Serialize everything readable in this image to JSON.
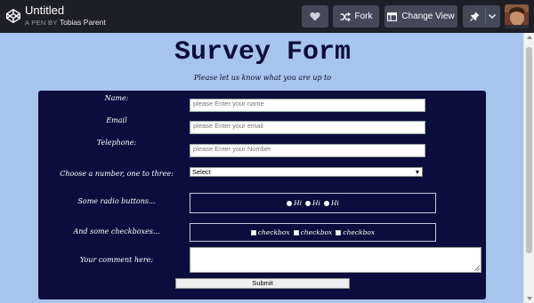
{
  "header": {
    "title": "Untitled",
    "by_prefix": "A PEN BY",
    "author": "Tobias Parent",
    "fork_label": "Fork",
    "change_view_label": "Change View"
  },
  "survey": {
    "title": "Survey Form",
    "description": "Please let us know what you are up to",
    "fields": {
      "name_label": "Name:",
      "name_placeholder": "please Enter your name",
      "email_label": "Email",
      "email_placeholder": "please Enter your email",
      "phone_label": "Telephone:",
      "phone_placeholder": "please Enter your Number",
      "number_label": "Choose a number, one to three:",
      "number_selected": "Select",
      "radio_label": "Some radio buttons...",
      "radio_options": [
        "Hi",
        "Hi",
        "Hi"
      ],
      "checkbox_label": "And some checkboxes...",
      "checkbox_options": [
        "checkbox",
        "checkbox",
        "checkbox"
      ],
      "comment_label": "Your comment here:"
    },
    "submit_label": "Submit"
  },
  "colors": {
    "topbar_bg": "#1e1f26",
    "button_bg": "#444857",
    "page_bg": "#a7c4ef",
    "panel_bg": "#0d0d3d",
    "title_color": "#0c0c3a"
  },
  "icons": [
    "codepen-logo-icon",
    "heart-icon",
    "fork-icon",
    "change-view-icon",
    "pin-icon",
    "chevron-down-icon"
  ]
}
